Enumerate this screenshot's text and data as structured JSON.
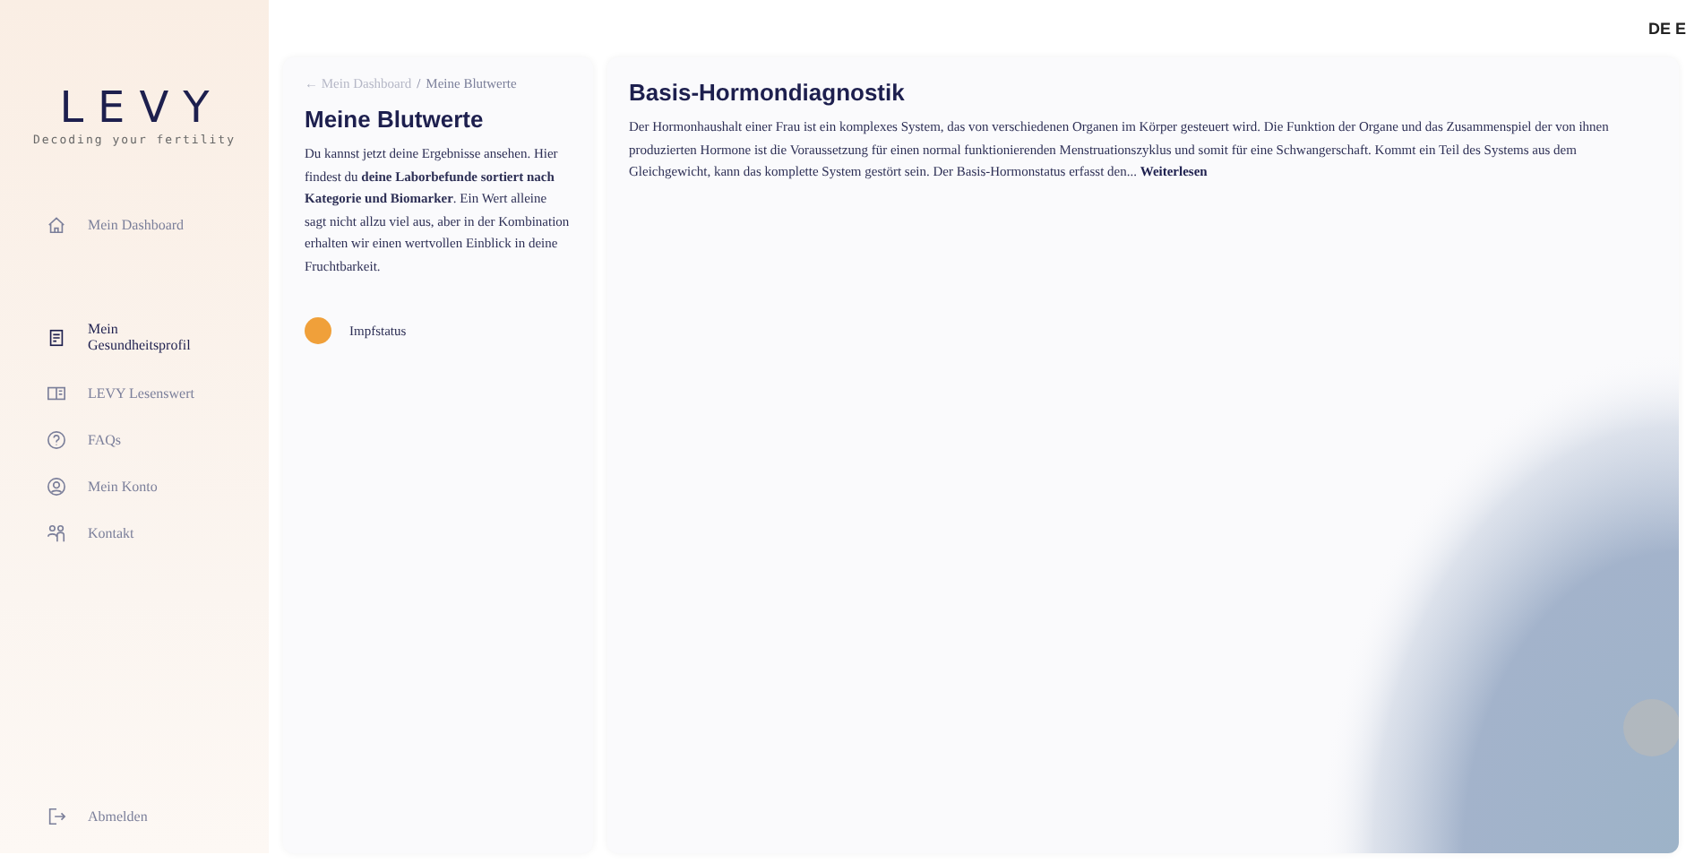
{
  "top_bar": {
    "language": "DE E"
  },
  "sidebar": {
    "logo": "LEVY",
    "tagline": "Decoding your fertility",
    "items": [
      {
        "label": "Mein Dashboard",
        "kind": "home",
        "selected": false
      },
      {
        "label": "Mein Gesundheitsprofil",
        "kind": "profile",
        "selected": true
      },
      {
        "label": "LEVY Lesenswert",
        "kind": "book",
        "selected": false
      },
      {
        "label": "FAQs",
        "kind": "help",
        "selected": false
      },
      {
        "label": "Mein Konto",
        "kind": "user",
        "selected": false
      },
      {
        "label": "Kontakt",
        "kind": "people",
        "selected": false
      }
    ],
    "logout": "Abmelden"
  },
  "left_panel": {
    "breadcrumb_back": "← Mein Dashboard",
    "breadcrumb_separator": "/",
    "breadcrumb_current": "Meine Blutwerte",
    "title": "Meine Blutwerte",
    "intro": "Du kannst jetzt deine Ergebnisse ansehen. Hier findest du **deine Laborbefunde sortiert nach Kategorie und Biomarker**. Ein Wert alleine sagt nicht allzu viel aus, aber in der Kombination erhalten wir einen wertvollen Einblick in deine Fruchtbarkeit.",
    "categories": [
      {
        "label": "Impfstatus",
        "color": "#f0a03a"
      }
    ]
  },
  "detail": {
    "title": "Basis-Hormondiagnostik",
    "text": "Der Hormonhaushalt einer Frau ist ein komplexes System, das von verschiedenen Organen im Körper gesteuert wird. Die Funktion der Organe und das Zusammenspiel der von ihnen produzierten Hormone ist die Voraussetzung für einen normal funktionierenden Menstruationszyklus und somit für eine Schwangerschaft. Kommt ein Teil des Systems aus dem Gleichgewicht, kann das komplette System gestört sein. Der Basis-Hormonstatus erfasst den...",
    "read_more": "Weiterlesen"
  }
}
